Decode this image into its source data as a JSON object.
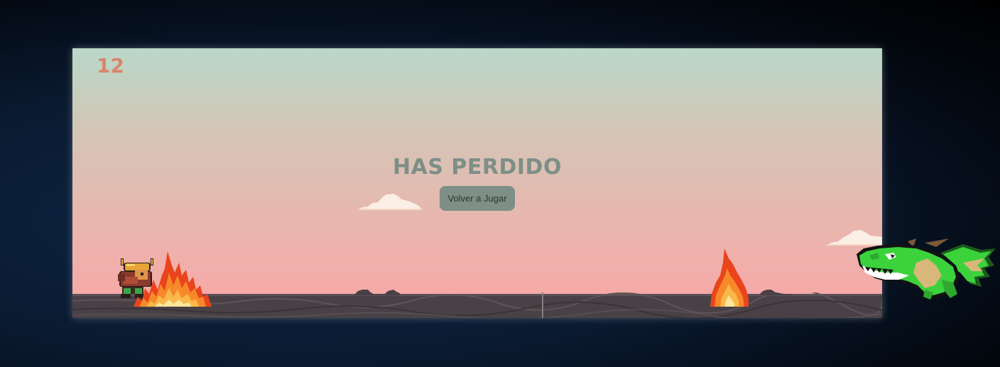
{
  "hud": {
    "score": "12"
  },
  "game_over": {
    "title": "HAS PERDIDO",
    "replay_label": "Volver a Jugar"
  },
  "colors": {
    "sky_top": "#b9d8c8",
    "sky_bottom": "#f4a8a8",
    "score": "#d9856d",
    "overlay_gray": "#7d8f86",
    "ground": "#4a4146",
    "dragon_green": "#3cd23c"
  },
  "sprites": {
    "player": "viking-warrior",
    "obstacles": [
      "fire",
      "fire"
    ],
    "enemy": "green-dragon"
  }
}
